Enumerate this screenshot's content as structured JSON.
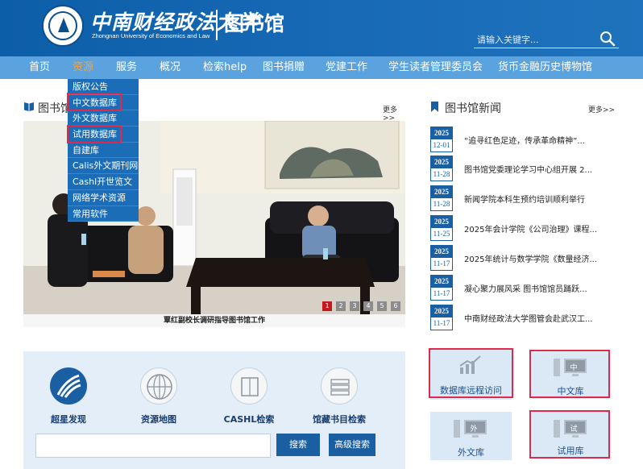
{
  "header": {
    "university_cn": "中南财经政法大学",
    "university_en": "Zhongnan University of Economics and Law",
    "library_title": "图书馆",
    "search_placeholder": "请输入关键字..."
  },
  "nav": {
    "items": [
      "首页",
      "资源",
      "服务",
      "概况",
      "检索help",
      "图书捐赠",
      "党建工作",
      "学生读者管理委员会",
      "货币金融历史博物馆"
    ],
    "active_index": 1
  },
  "dropdown": {
    "items": [
      "版权公告",
      "中文数据库",
      "外文数据库",
      "试用数据库",
      "自建库",
      "Calis外文期刊网",
      "Cashl开世览文",
      "网络学术资源",
      "常用软件"
    ],
    "highlighted": [
      "中文数据库",
      "试用数据库"
    ]
  },
  "slideshow": {
    "section_title": "图书馆",
    "more": "更多>>",
    "caption": "覃红副校长调研指导图书馆工作",
    "pages": [
      "1",
      "2",
      "3",
      "4",
      "5",
      "6"
    ],
    "active_page": "1"
  },
  "news": {
    "section_title": "图书馆新闻",
    "more": "更多>>",
    "items": [
      {
        "year": "2025",
        "day": "12-01",
        "title": "“追寻红色足迹，传承革命精神”..."
      },
      {
        "year": "2025",
        "day": "11-28",
        "title": "图书馆党委理论学习中心组开展 2..."
      },
      {
        "year": "2025",
        "day": "11-28",
        "title": "新闻学院本科生预约培训顺利举行"
      },
      {
        "year": "2025",
        "day": "11-25",
        "title": "2025年会计学院《公司治理》课程..."
      },
      {
        "year": "2025",
        "day": "11-17",
        "title": "2025年统计与数学学院《数量经济..."
      },
      {
        "year": "2025",
        "day": "11-17",
        "title": "凝心聚力展风采 图书馆馆员踊跃..."
      },
      {
        "year": "2025",
        "day": "11-17",
        "title": "中南财经政法大学图管会赴武汉工..."
      }
    ]
  },
  "search_panel": {
    "tools": [
      "超星发现",
      "资源地图",
      "CASHL检索",
      "馆藏书目检索"
    ],
    "search_button": "搜索",
    "advanced_button": "高级搜索",
    "input_value": ""
  },
  "tiles": {
    "remote": "数据库远程访问",
    "chinese": "中文库",
    "chinese_icon_char": "中",
    "foreign": "外文库",
    "foreign_icon_char": "外",
    "trial": "试用库",
    "trial_icon_char": "试"
  },
  "colors": {
    "header_blue": "#1769b5",
    "nav_blue": "#5aa3de",
    "active_orange": "#f2a341",
    "highlight_red": "#e0284a",
    "dark_blue": "#1b5fa3"
  }
}
